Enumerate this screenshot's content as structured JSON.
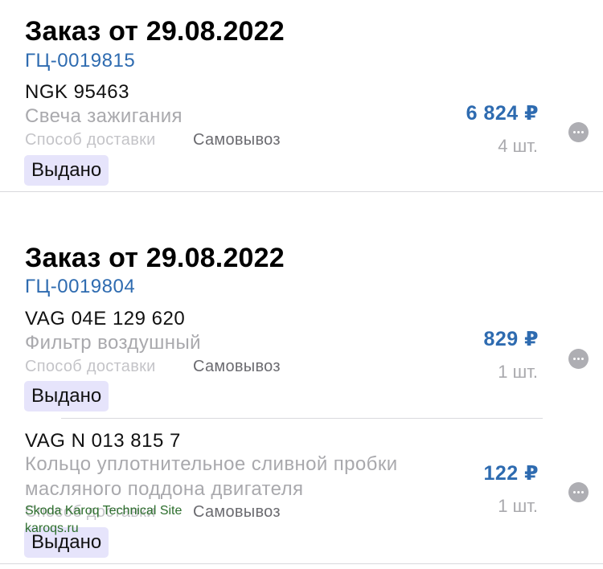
{
  "orders": [
    {
      "title": "Заказ от 29.08.2022",
      "id": "ГЦ-0019815",
      "items": [
        {
          "part_no": "NGK 95463",
          "name": "Свеча зажигания",
          "delivery_label": "Способ доставки",
          "delivery_value": "Самовывоз",
          "status": "Выдано",
          "price": "6 824 ₽",
          "qty": "4 шт."
        }
      ]
    },
    {
      "title": "Заказ от 29.08.2022",
      "id": "ГЦ-0019804",
      "items": [
        {
          "part_no": "VAG 04E 129 620",
          "name": "Фильтр воздушный",
          "delivery_label": "Способ доставки",
          "delivery_value": "Самовывоз",
          "status": "Выдано",
          "price": "829 ₽",
          "qty": "1 шт."
        },
        {
          "part_no": "VAG N  013 815 7",
          "name_line1": "Кольцо уплотнительное сливной пробки",
          "name_line2": "масляного поддона двигателя",
          "delivery_label": "Способ доставки",
          "delivery_value": "Самовывоз",
          "status": "Выдано",
          "price": "122 ₽",
          "qty": "1 шт."
        }
      ]
    }
  ],
  "watermark": {
    "line1": "Skoda Karoq Technical Site",
    "line2": "karoqs.ru"
  },
  "icons": {
    "more": "more-horizontal-icon"
  },
  "colors": {
    "accent": "#2e6bb0",
    "badge_bg": "#e6e4fb",
    "muted": "#a9a9ad"
  }
}
